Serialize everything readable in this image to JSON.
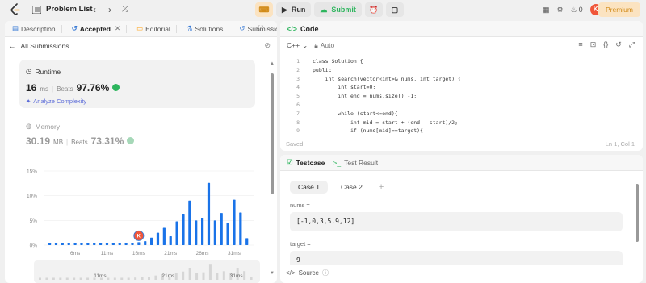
{
  "nav": {
    "problem_list": "Problem List",
    "run": "Run",
    "submit": "Submit",
    "coins": "0",
    "avatar_letter": "K",
    "premium": "Premium",
    "colors": {
      "brand": "#ffa116",
      "submit": "#2db55d",
      "premium": "#d18a17"
    }
  },
  "left_tabs": [
    {
      "label": "Description",
      "icon": "document-icon"
    },
    {
      "label": "Accepted",
      "icon": "history-icon"
    },
    {
      "label": "Editorial",
      "icon": "book-icon"
    },
    {
      "label": "Solutions",
      "icon": "flask-icon"
    },
    {
      "label": "Submission",
      "icon": "history-icon"
    }
  ],
  "all_submissions": "All Submissions",
  "runtime": {
    "title": "Runtime",
    "value": "16",
    "unit": "ms",
    "beats_label": "Beats",
    "beats_pct": "97.76%",
    "analyze": "Analyze Complexity"
  },
  "memory": {
    "title": "Memory",
    "value": "30.19",
    "unit": "MB",
    "beats_label": "Beats",
    "beats_pct": "73.31%"
  },
  "chart_data": {
    "type": "bar",
    "y_ticks": [
      "15%",
      "10%",
      "5%",
      "0%"
    ],
    "ylim": [
      0,
      15
    ],
    "x_ticks": [
      "6ms",
      "11ms",
      "16ms",
      "21ms",
      "26ms",
      "31ms"
    ],
    "values": [
      0.4,
      0.4,
      0.4,
      0.4,
      0.4,
      0.4,
      0.4,
      0.4,
      0.4,
      0.4,
      0.4,
      0.4,
      0.4,
      0.4,
      0.6,
      0.8,
      1.5,
      2.5,
      3.5,
      1.8,
      4.8,
      6.2,
      9.0,
      5.0,
      5.5,
      12.6,
      5.0,
      6.5,
      4.5,
      9.2,
      6.6,
      1.4
    ],
    "marker_index": 14,
    "marker_letter": "K",
    "colors": {
      "bar": "#1a73e8",
      "marker": "#f0563a"
    },
    "minimap_ticks": [
      "11ms",
      "21ms",
      "31ms"
    ]
  },
  "code": {
    "title": "Code",
    "language": "C++",
    "mode": "Auto",
    "lines": [
      "class Solution {",
      "public:",
      "    int search(vector<int>& nums, int target) {",
      "        int start=0;",
      "        int end = nums.size() -1;",
      "",
      "        while (start<=end){",
      "            int mid = start + (end - start)/2;",
      "            if (nums[mid]==target){"
    ],
    "line_numbers": [
      "1",
      "2",
      "3",
      "4",
      "5",
      "6",
      "7",
      "8",
      "9"
    ],
    "saved": "Saved",
    "position": "Ln 1, Col 1"
  },
  "testcase": {
    "tab_testcase": "Testcase",
    "tab_result": "Test Result",
    "case1": "Case 1",
    "case2": "Case 2",
    "nums_label": "nums =",
    "nums_value": "[-1,0,3,5,9,12]",
    "target_label": "target =",
    "target_value": "9",
    "source": "Source"
  }
}
